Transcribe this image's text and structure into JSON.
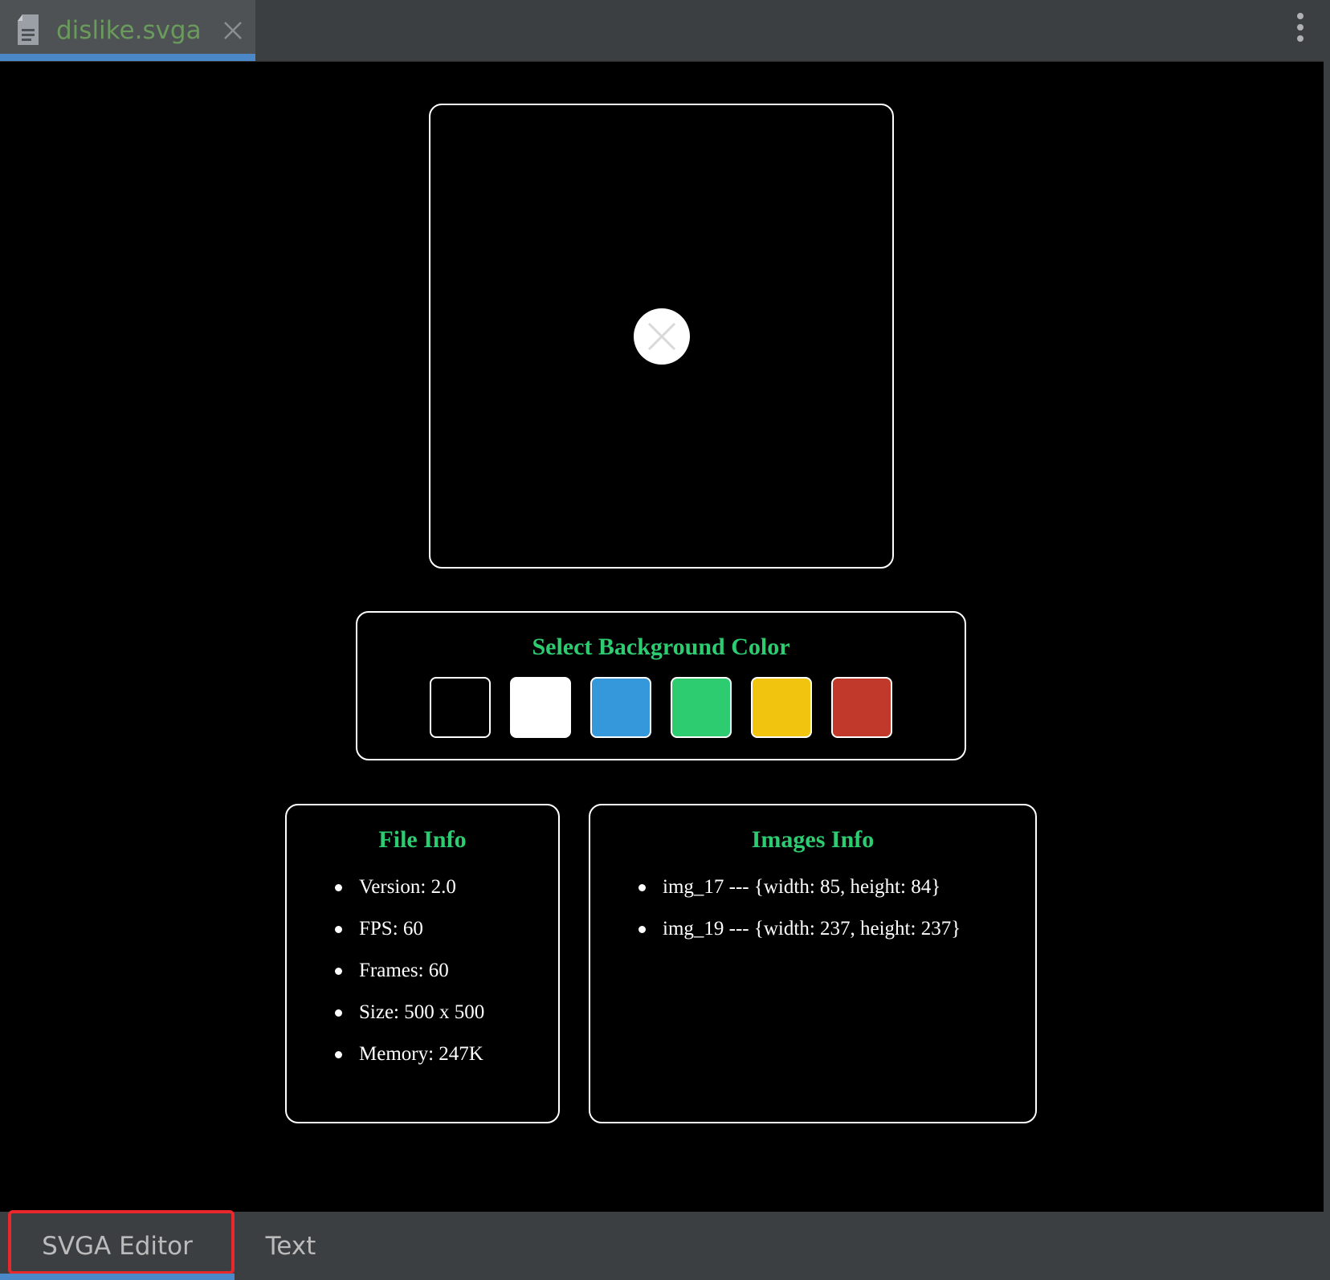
{
  "tab": {
    "file_name": "dislike.svga"
  },
  "background_picker": {
    "title": "Select Background Color",
    "colors": [
      "#000000",
      "#ffffff",
      "#3498db",
      "#2ecc71",
      "#f1c40f",
      "#c0392b"
    ]
  },
  "file_info": {
    "title": "File Info",
    "items": [
      "Version: 2.0",
      "FPS: 60",
      "Frames: 60",
      "Size: 500 x 500",
      "Memory: 247K"
    ]
  },
  "images_info": {
    "title": "Images Info",
    "items": [
      "img_17 --- {width: 85, height: 84}",
      "img_19 --- {width: 237, height: 237}"
    ]
  },
  "bottom_tabs": {
    "editor_label": "SVGA Editor",
    "text_label": "Text"
  }
}
